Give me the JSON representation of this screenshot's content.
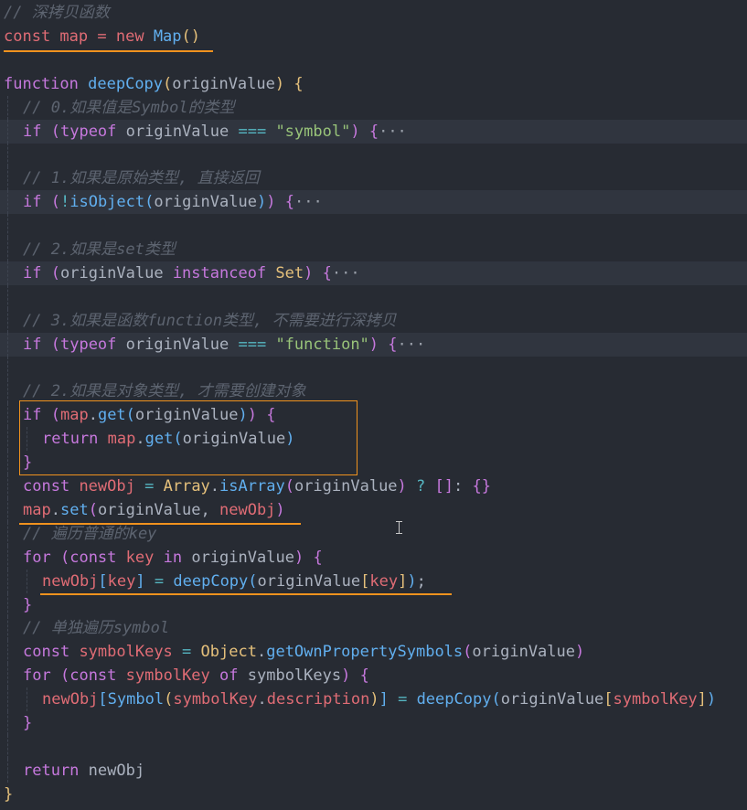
{
  "editor": {
    "lines": [
      {
        "indent": 0,
        "folded": false,
        "tokens": [
          {
            "t": "// 深拷贝函数",
            "c": "c"
          }
        ]
      },
      {
        "indent": 0,
        "folded": false,
        "tokens": [
          {
            "t": "const",
            "c": "v"
          },
          {
            "t": " map = ",
            "c": "v"
          },
          {
            "t": "new",
            "c": "v"
          },
          {
            "t": " ",
            "c": "p"
          },
          {
            "t": "Map",
            "c": "f"
          },
          {
            "t": "()",
            "c": "b1"
          }
        ]
      },
      {
        "indent": 0,
        "folded": false,
        "tokens": []
      },
      {
        "indent": 0,
        "folded": false,
        "tokens": [
          {
            "t": "function",
            "c": "k"
          },
          {
            "t": " ",
            "c": "p"
          },
          {
            "t": "deepCopy",
            "c": "f"
          },
          {
            "t": "(",
            "c": "b1"
          },
          {
            "t": "originValue",
            "c": "p"
          },
          {
            "t": ")",
            "c": "b1"
          },
          {
            "t": " ",
            "c": "p"
          },
          {
            "t": "{",
            "c": "b1"
          }
        ]
      },
      {
        "indent": 1,
        "folded": false,
        "tokens": [
          {
            "t": "// 0.如果值是Symbol的类型",
            "c": "c"
          }
        ]
      },
      {
        "indent": 1,
        "folded": true,
        "tokens": [
          {
            "t": "if",
            "c": "k"
          },
          {
            "t": " ",
            "c": "p"
          },
          {
            "t": "(",
            "c": "b2"
          },
          {
            "t": "typeof",
            "c": "k"
          },
          {
            "t": " originValue ",
            "c": "p"
          },
          {
            "t": "===",
            "c": "o"
          },
          {
            "t": " ",
            "c": "p"
          },
          {
            "t": "\"symbol\"",
            "c": "s"
          },
          {
            "t": ")",
            "c": "b2"
          },
          {
            "t": " ",
            "c": "p"
          },
          {
            "t": "{",
            "c": "b2"
          },
          {
            "t": "···",
            "c": "e"
          }
        ]
      },
      {
        "indent": 1,
        "folded": false,
        "tokens": []
      },
      {
        "indent": 1,
        "folded": false,
        "tokens": [
          {
            "t": "// 1.如果是原始类型, 直接返回",
            "c": "c"
          }
        ]
      },
      {
        "indent": 1,
        "folded": true,
        "tokens": [
          {
            "t": "if",
            "c": "k"
          },
          {
            "t": " ",
            "c": "p"
          },
          {
            "t": "(",
            "c": "b2"
          },
          {
            "t": "!",
            "c": "o"
          },
          {
            "t": "isObject",
            "c": "f"
          },
          {
            "t": "(",
            "c": "b3"
          },
          {
            "t": "originValue",
            "c": "p"
          },
          {
            "t": ")",
            "c": "b3"
          },
          {
            "t": ")",
            "c": "b2"
          },
          {
            "t": " ",
            "c": "p"
          },
          {
            "t": "{",
            "c": "b2"
          },
          {
            "t": "···",
            "c": "e"
          }
        ]
      },
      {
        "indent": 1,
        "folded": false,
        "tokens": []
      },
      {
        "indent": 1,
        "folded": false,
        "tokens": [
          {
            "t": "// 2.如果是set类型",
            "c": "c"
          }
        ]
      },
      {
        "indent": 1,
        "folded": true,
        "tokens": [
          {
            "t": "if",
            "c": "k"
          },
          {
            "t": " ",
            "c": "p"
          },
          {
            "t": "(",
            "c": "b2"
          },
          {
            "t": "originValue ",
            "c": "p"
          },
          {
            "t": "instanceof",
            "c": "k"
          },
          {
            "t": " ",
            "c": "p"
          },
          {
            "t": "Set",
            "c": "cls"
          },
          {
            "t": ")",
            "c": "b2"
          },
          {
            "t": " ",
            "c": "p"
          },
          {
            "t": "{",
            "c": "b2"
          },
          {
            "t": "···",
            "c": "e"
          }
        ]
      },
      {
        "indent": 1,
        "folded": false,
        "tokens": []
      },
      {
        "indent": 1,
        "folded": false,
        "tokens": [
          {
            "t": "// 3.如果是函数function类型, 不需要进行深拷贝",
            "c": "c"
          }
        ]
      },
      {
        "indent": 1,
        "folded": true,
        "tokens": [
          {
            "t": "if",
            "c": "k"
          },
          {
            "t": " ",
            "c": "p"
          },
          {
            "t": "(",
            "c": "b2"
          },
          {
            "t": "typeof",
            "c": "k"
          },
          {
            "t": " originValue ",
            "c": "p"
          },
          {
            "t": "===",
            "c": "o"
          },
          {
            "t": " ",
            "c": "p"
          },
          {
            "t": "\"function\"",
            "c": "s"
          },
          {
            "t": ")",
            "c": "b2"
          },
          {
            "t": " ",
            "c": "p"
          },
          {
            "t": "{",
            "c": "b2"
          },
          {
            "t": "···",
            "c": "e"
          }
        ]
      },
      {
        "indent": 1,
        "folded": false,
        "tokens": []
      },
      {
        "indent": 1,
        "folded": false,
        "tokens": [
          {
            "t": "// 2.如果是对象类型, 才需要创建对象",
            "c": "c"
          }
        ]
      },
      {
        "indent": 1,
        "folded": false,
        "tokens": [
          {
            "t": "if",
            "c": "k"
          },
          {
            "t": " ",
            "c": "p"
          },
          {
            "t": "(",
            "c": "b2"
          },
          {
            "t": "map",
            "c": "v"
          },
          {
            "t": ".",
            "c": "p"
          },
          {
            "t": "get",
            "c": "f"
          },
          {
            "t": "(",
            "c": "b3"
          },
          {
            "t": "originValue",
            "c": "p"
          },
          {
            "t": ")",
            "c": "b3"
          },
          {
            "t": ")",
            "c": "b2"
          },
          {
            "t": " ",
            "c": "p"
          },
          {
            "t": "{",
            "c": "b2"
          }
        ]
      },
      {
        "indent": 2,
        "folded": false,
        "tokens": [
          {
            "t": "return",
            "c": "k"
          },
          {
            "t": " ",
            "c": "p"
          },
          {
            "t": "map",
            "c": "v"
          },
          {
            "t": ".",
            "c": "p"
          },
          {
            "t": "get",
            "c": "f"
          },
          {
            "t": "(",
            "c": "b3"
          },
          {
            "t": "originValue",
            "c": "p"
          },
          {
            "t": ")",
            "c": "b3"
          }
        ]
      },
      {
        "indent": 1,
        "folded": false,
        "tokens": [
          {
            "t": "}",
            "c": "b2"
          }
        ]
      },
      {
        "indent": 1,
        "folded": false,
        "tokens": [
          {
            "t": "const",
            "c": "k"
          },
          {
            "t": " ",
            "c": "p"
          },
          {
            "t": "newObj",
            "c": "v"
          },
          {
            "t": " ",
            "c": "p"
          },
          {
            "t": "=",
            "c": "o"
          },
          {
            "t": " ",
            "c": "p"
          },
          {
            "t": "Array",
            "c": "cls"
          },
          {
            "t": ".",
            "c": "p"
          },
          {
            "t": "isArray",
            "c": "f"
          },
          {
            "t": "(",
            "c": "b2"
          },
          {
            "t": "originValue",
            "c": "p"
          },
          {
            "t": ")",
            "c": "b2"
          },
          {
            "t": " ",
            "c": "p"
          },
          {
            "t": "?",
            "c": "o"
          },
          {
            "t": " ",
            "c": "p"
          },
          {
            "t": "[]",
            "c": "b2"
          },
          {
            "t": ": ",
            "c": "p"
          },
          {
            "t": "{}",
            "c": "b2"
          }
        ]
      },
      {
        "indent": 1,
        "folded": false,
        "tokens": [
          {
            "t": "map",
            "c": "v"
          },
          {
            "t": ".",
            "c": "p"
          },
          {
            "t": "set",
            "c": "f"
          },
          {
            "t": "(",
            "c": "b2"
          },
          {
            "t": "originValue, ",
            "c": "p"
          },
          {
            "t": "newObj",
            "c": "v"
          },
          {
            "t": ")",
            "c": "b2"
          }
        ]
      },
      {
        "indent": 1,
        "folded": false,
        "tokens": [
          {
            "t": "// 遍历普通的key",
            "c": "c"
          }
        ]
      },
      {
        "indent": 1,
        "folded": false,
        "tokens": [
          {
            "t": "for",
            "c": "k"
          },
          {
            "t": " ",
            "c": "p"
          },
          {
            "t": "(",
            "c": "b2"
          },
          {
            "t": "const",
            "c": "k"
          },
          {
            "t": " ",
            "c": "p"
          },
          {
            "t": "key",
            "c": "v"
          },
          {
            "t": " ",
            "c": "p"
          },
          {
            "t": "in",
            "c": "k"
          },
          {
            "t": " originValue",
            "c": "p"
          },
          {
            "t": ")",
            "c": "b2"
          },
          {
            "t": " ",
            "c": "p"
          },
          {
            "t": "{",
            "c": "b2"
          }
        ]
      },
      {
        "indent": 2,
        "folded": false,
        "tokens": [
          {
            "t": "newObj",
            "c": "v"
          },
          {
            "t": "[",
            "c": "b3"
          },
          {
            "t": "key",
            "c": "v"
          },
          {
            "t": "]",
            "c": "b3"
          },
          {
            "t": " ",
            "c": "p"
          },
          {
            "t": "=",
            "c": "o"
          },
          {
            "t": " ",
            "c": "p"
          },
          {
            "t": "deepCopy",
            "c": "f"
          },
          {
            "t": "(",
            "c": "b3"
          },
          {
            "t": "originValue",
            "c": "p"
          },
          {
            "t": "[",
            "c": "b1"
          },
          {
            "t": "key",
            "c": "v"
          },
          {
            "t": "]",
            "c": "b1"
          },
          {
            "t": ")",
            "c": "b3"
          },
          {
            "t": ";",
            "c": "p"
          }
        ]
      },
      {
        "indent": 1,
        "folded": false,
        "tokens": [
          {
            "t": "}",
            "c": "b2"
          }
        ]
      },
      {
        "indent": 1,
        "folded": false,
        "tokens": [
          {
            "t": "// 单独遍历symbol",
            "c": "c"
          }
        ]
      },
      {
        "indent": 1,
        "folded": false,
        "tokens": [
          {
            "t": "const",
            "c": "k"
          },
          {
            "t": " ",
            "c": "p"
          },
          {
            "t": "symbolKeys",
            "c": "v"
          },
          {
            "t": " ",
            "c": "p"
          },
          {
            "t": "=",
            "c": "o"
          },
          {
            "t": " ",
            "c": "p"
          },
          {
            "t": "Object",
            "c": "cls"
          },
          {
            "t": ".",
            "c": "p"
          },
          {
            "t": "getOwnPropertySymbols",
            "c": "f"
          },
          {
            "t": "(",
            "c": "b2"
          },
          {
            "t": "originValue",
            "c": "p"
          },
          {
            "t": ")",
            "c": "b2"
          }
        ]
      },
      {
        "indent": 1,
        "folded": false,
        "tokens": [
          {
            "t": "for",
            "c": "k"
          },
          {
            "t": " ",
            "c": "p"
          },
          {
            "t": "(",
            "c": "b2"
          },
          {
            "t": "const",
            "c": "k"
          },
          {
            "t": " ",
            "c": "p"
          },
          {
            "t": "symbolKey",
            "c": "v"
          },
          {
            "t": " ",
            "c": "p"
          },
          {
            "t": "of",
            "c": "k"
          },
          {
            "t": " symbolKeys",
            "c": "p"
          },
          {
            "t": ")",
            "c": "b2"
          },
          {
            "t": " ",
            "c": "p"
          },
          {
            "t": "{",
            "c": "b2"
          }
        ]
      },
      {
        "indent": 2,
        "folded": false,
        "tokens": [
          {
            "t": "newObj",
            "c": "v"
          },
          {
            "t": "[",
            "c": "b3"
          },
          {
            "t": "Symbol",
            "c": "f"
          },
          {
            "t": "(",
            "c": "b1"
          },
          {
            "t": "symbolKey",
            "c": "v"
          },
          {
            "t": ".",
            "c": "p"
          },
          {
            "t": "description",
            "c": "v"
          },
          {
            "t": ")",
            "c": "b1"
          },
          {
            "t": "]",
            "c": "b3"
          },
          {
            "t": " ",
            "c": "p"
          },
          {
            "t": "=",
            "c": "o"
          },
          {
            "t": " ",
            "c": "p"
          },
          {
            "t": "deepCopy",
            "c": "f"
          },
          {
            "t": "(",
            "c": "b3"
          },
          {
            "t": "originValue",
            "c": "p"
          },
          {
            "t": "[",
            "c": "b1"
          },
          {
            "t": "symbolKey",
            "c": "v"
          },
          {
            "t": "]",
            "c": "b1"
          },
          {
            "t": ")",
            "c": "b3"
          }
        ]
      },
      {
        "indent": 1,
        "folded": false,
        "tokens": [
          {
            "t": "}",
            "c": "b2"
          }
        ]
      },
      {
        "indent": 1,
        "folded": false,
        "tokens": []
      },
      {
        "indent": 1,
        "folded": false,
        "tokens": [
          {
            "t": "return",
            "c": "k"
          },
          {
            "t": " newObj",
            "c": "p"
          }
        ]
      },
      {
        "indent": 0,
        "folded": false,
        "tokens": [
          {
            "t": "}",
            "c": "b1"
          }
        ]
      }
    ]
  },
  "colors": {
    "background": "#272b33",
    "highlight": "#f0921e"
  }
}
